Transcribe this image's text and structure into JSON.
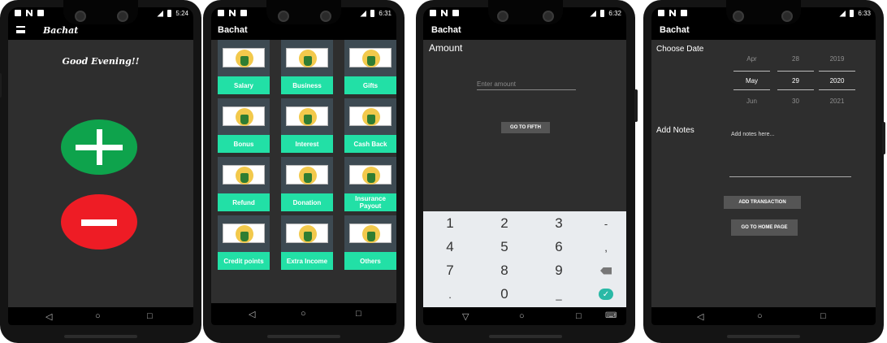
{
  "screen1": {
    "time": "5:24",
    "app_title": "Bachat",
    "greeting": "Good Evening!!"
  },
  "screen2": {
    "time": "6:31",
    "app_title": "Bachat",
    "categories": [
      "Salary",
      "Business",
      "Gifts",
      "Bonus",
      "Interest",
      "Cash Back",
      "Refund",
      "Donation",
      "Insurance Payout",
      "Credit points",
      "Extra Income",
      "Others"
    ]
  },
  "screen3": {
    "time": "6:32",
    "app_title": "Bachat",
    "amount_label": "Amount",
    "amount_placeholder": "Enter amount",
    "go_button": "GO TO FIFTH",
    "keys": [
      "1",
      "2",
      "3",
      "-",
      "4",
      "5",
      "6",
      ",",
      "7",
      "8",
      "9",
      "",
      ".",
      "0",
      "_",
      ""
    ]
  },
  "screen4": {
    "time": "6:33",
    "app_title": "Bachat",
    "choose_date_label": "Choose Date",
    "picker": {
      "months": [
        "Apr",
        "May",
        "Jun"
      ],
      "days": [
        "28",
        "29",
        "30"
      ],
      "years": [
        "2019",
        "2020",
        "2021"
      ]
    },
    "add_notes_label": "Add Notes",
    "notes_placeholder": "Add notes here...",
    "add_button": "ADD TRANSACTION",
    "home_button": "GO TO HOME PAGE"
  },
  "colors": {
    "accent_green": "#22e0a6",
    "plus_green": "#0ea34c",
    "minus_red": "#ee1c25",
    "check_teal": "#2ab9a6"
  }
}
